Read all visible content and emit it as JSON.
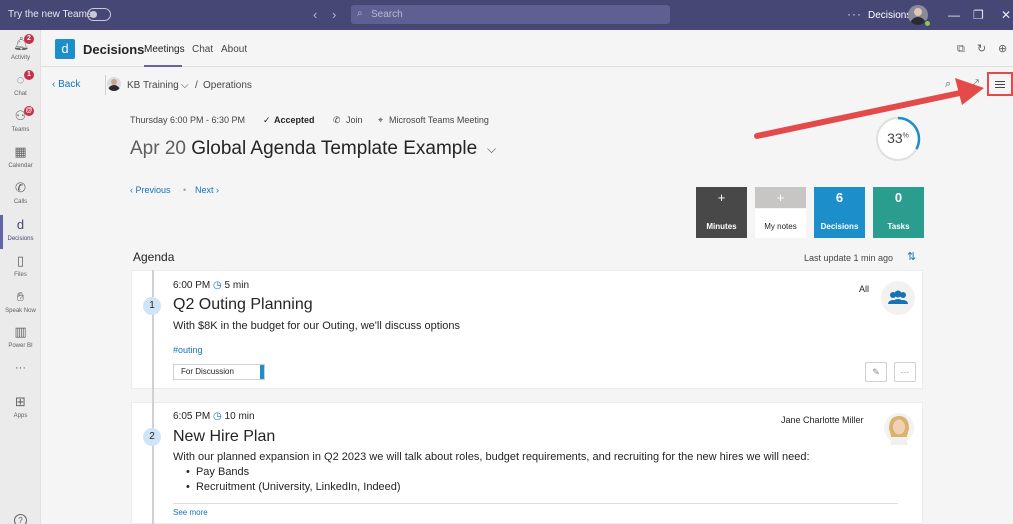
{
  "titlebar": {
    "try_label": "Try the new Teams",
    "search_placeholder": "Search",
    "more": "···",
    "org": "Decisions",
    "min": "—",
    "max": "❐",
    "close": "✕"
  },
  "rail": {
    "items": [
      {
        "label": "Activity",
        "badge": "2"
      },
      {
        "label": "Chat",
        "badge": "1"
      },
      {
        "label": "Teams",
        "badge": "@"
      },
      {
        "label": "Calendar"
      },
      {
        "label": "Calls"
      },
      {
        "label": "Decisions"
      },
      {
        "label": "Files"
      },
      {
        "label": "Speak Now"
      },
      {
        "label": "Power BI"
      },
      {
        "label": "Apps"
      }
    ],
    "more": "···",
    "help": "?"
  },
  "app": {
    "logo": "d",
    "name": "Decisions",
    "tabs": [
      "Meetings",
      "Chat",
      "About"
    ]
  },
  "subbar": {
    "back": "Back",
    "crumb_team": "KB Training",
    "crumb_sep": "/",
    "crumb_channel": "Operations"
  },
  "meeting": {
    "day_time": "Thursday  6:00 PM - 6:30 PM",
    "accepted": "Accepted",
    "join": "Join",
    "location": "Microsoft Teams Meeting",
    "date": "Apr 20",
    "title": "Global Agenda Template Example",
    "progress_value": "33",
    "progress_unit": "%",
    "progress_fraction": 0.33,
    "previous": "Previous",
    "next": "Next",
    "dot": "•"
  },
  "tiles": {
    "minutes": {
      "top": "+",
      "label": "Minutes"
    },
    "notes": {
      "top": "+",
      "label": "My notes"
    },
    "decisions": {
      "top": "6",
      "label": "Decisions"
    },
    "tasks": {
      "top": "0",
      "label": "Tasks"
    }
  },
  "agenda": {
    "heading": "Agenda",
    "last_update": "Last update 1 min ago",
    "items": [
      {
        "number": "1",
        "time": "6:00 PM",
        "duration": "5 min",
        "title": "Q2 Outing Planning",
        "description": "With $8K in the budget for our Outing, we'll discuss options",
        "tag": "#outing",
        "status": "For Discussion",
        "assignee": "All"
      },
      {
        "number": "2",
        "time": "6:05 PM",
        "duration": "10 min",
        "title": "New Hire Plan",
        "description": "With our planned expansion in Q2 2023 we will talk about roles, budget requirements, and recruiting for the new hires we will need:",
        "bullets": [
          "Pay Bands",
          "Recruitment (University, LinkedIn, Indeed)"
        ],
        "assignee": "Jane Charlotte Miller",
        "see_more": "See more"
      }
    ]
  },
  "colors": {
    "titlebar": "#464775",
    "accent": "#6264a7",
    "link": "#1473b6",
    "decisions_tile": "#1c8ec9",
    "tasks_tile": "#2a9d8f",
    "minutes_tile": "#484848",
    "annotation": "#e34a49"
  }
}
